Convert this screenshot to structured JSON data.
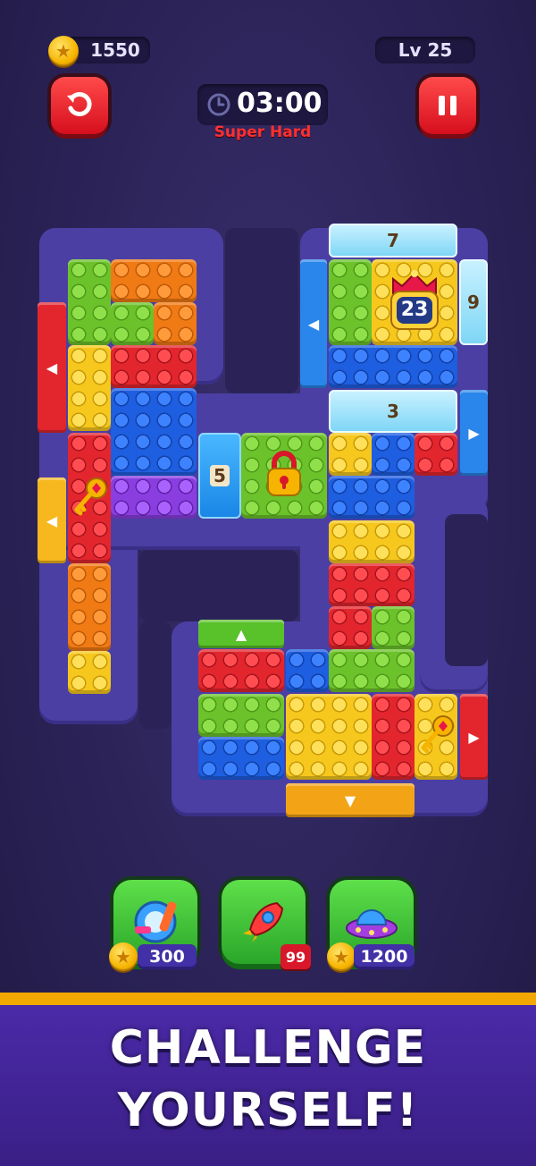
{
  "hud": {
    "coins": "1550",
    "level": "Lv 25",
    "timer": "03:00",
    "difficulty": "Super Hard"
  },
  "board": {
    "locked_crown_count": "23",
    "ice_counts": [
      "7",
      "9",
      "3",
      "5"
    ]
  },
  "boosters": [
    {
      "name": "gear-booster",
      "price": "300"
    },
    {
      "name": "rocket-booster",
      "count": "99"
    },
    {
      "name": "ufo-booster",
      "price": "1200"
    }
  ],
  "footer": {
    "line1": "CHALLENGE",
    "line2": "YOURSELF!"
  },
  "colors": {
    "background": "#2b2357",
    "track": "#4b3fa3",
    "accent_gold": "#f2a800",
    "difficulty_red": "#ff3030"
  }
}
